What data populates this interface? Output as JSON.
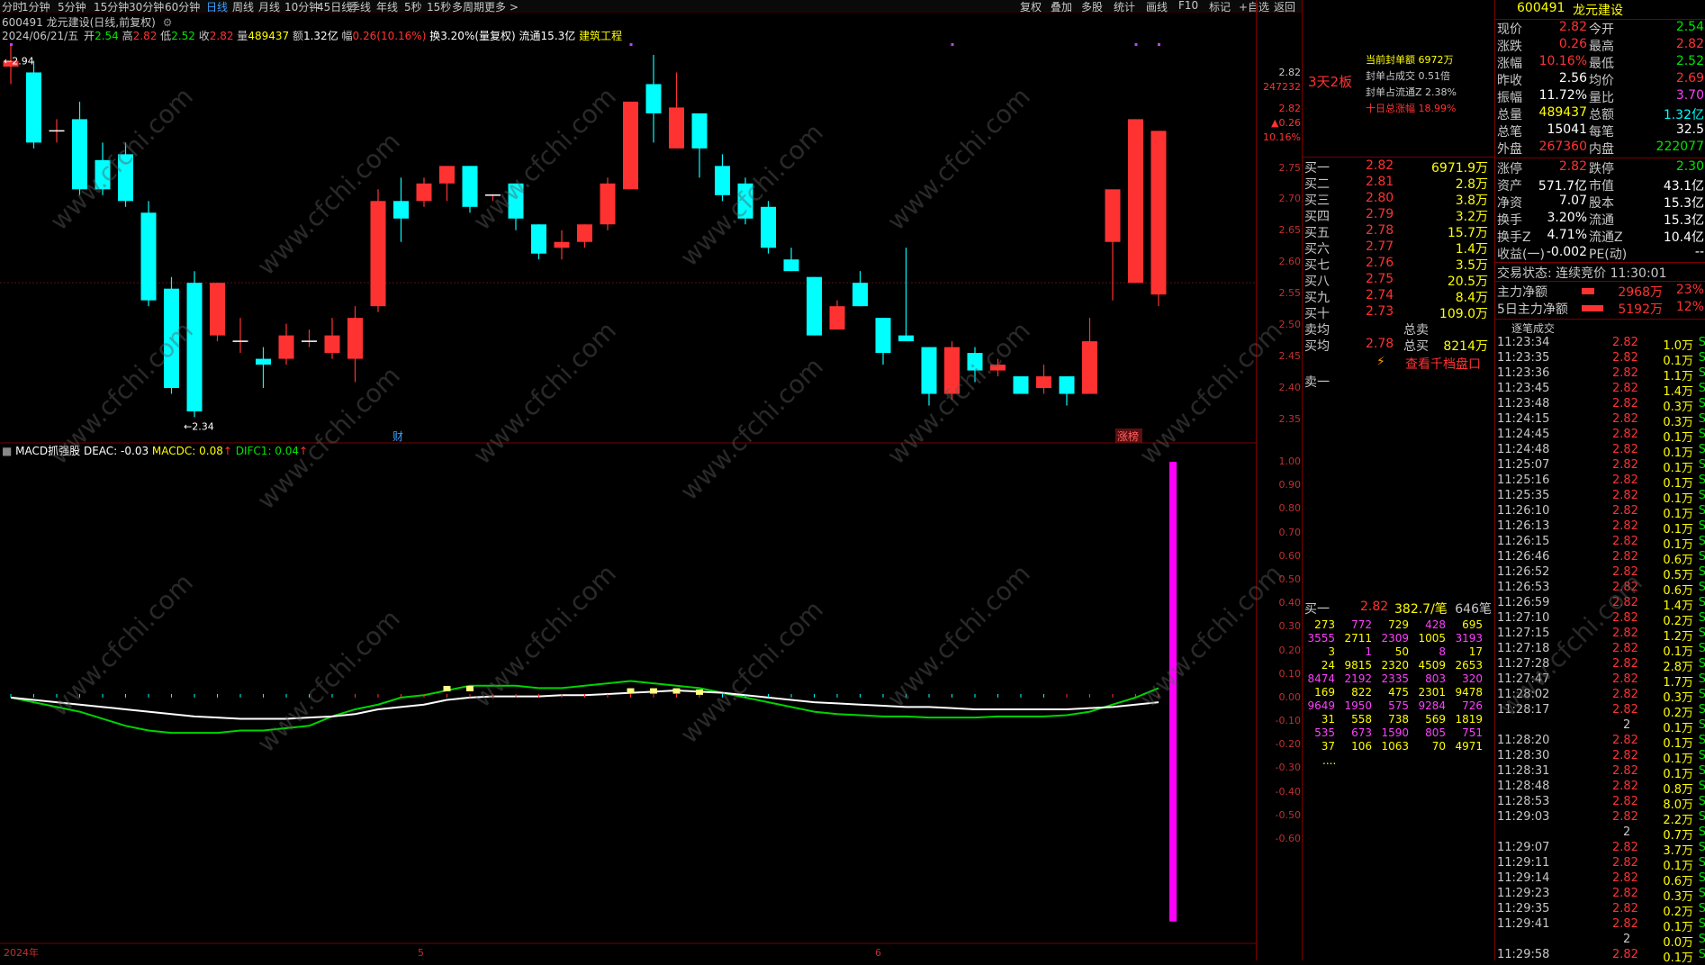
{
  "toolbar": {
    "periods": [
      "分时",
      "1分钟",
      "5分钟",
      "15分钟",
      "30分钟",
      "60分钟",
      "日线",
      "周线",
      "月线",
      "10分钟",
      "45日线",
      "季线",
      "年线",
      "5秒",
      "15秒",
      "多周期",
      "更多 >"
    ],
    "active": "日线",
    "right_tools": [
      "复权",
      "叠加",
      "多股",
      "统计",
      "画线",
      "F10",
      "标记",
      "+自选",
      "返回"
    ]
  },
  "chart": {
    "title": "600491 龙元建设(日线,前复权)",
    "date": "2024/06/21/五",
    "open_label": "开",
    "open": "2.54",
    "high_label": "高",
    "high": "2.82",
    "low_label": "低",
    "low": "2.52",
    "close_label": "收",
    "close": "2.82",
    "vol_label": "量",
    "vol": "489437",
    "amount_label": "额",
    "amount": "1.32亿",
    "change_label": "幅",
    "change": "0.26(10.16%)",
    "turnover": "换3.20%(量复权)",
    "float": "流通15.3亿",
    "sector": "建筑工程",
    "high_marker": "2.94",
    "low_marker": "2.34",
    "fin_marker": "财",
    "rank_marker": "涨榜",
    "price_axis": [
      "2.82",
      "247232",
      "2.82",
      "▲0.26",
      "10.16%",
      "2.75",
      "2.70",
      "2.65",
      "2.60",
      "2.55",
      "2.50",
      "2.45",
      "2.40",
      "2.35"
    ],
    "x_axis": [
      "2024年",
      "5",
      "6"
    ],
    "period_label": "日线"
  },
  "macd": {
    "title": "MACD抓强股",
    "deac": "DEAC: -0.03",
    "macdc": "MACDC: 0.08",
    "difc": "DIFC1: 0.04",
    "axis": [
      "1.00",
      "0.90",
      "0.80",
      "0.70",
      "0.60",
      "0.50",
      "0.40",
      "0.30",
      "0.20",
      "0.10",
      "0.00",
      "-0.10",
      "-0.20",
      "-0.30",
      "-0.40",
      "-0.50",
      "-0.60"
    ]
  },
  "chart_data": {
    "type": "candlestick",
    "candles": [
      [
        2.93,
        2.97,
        2.9,
        2.94
      ],
      [
        2.92,
        2.94,
        2.79,
        2.8
      ],
      [
        2.82,
        2.84,
        2.8,
        2.82
      ],
      [
        2.84,
        2.87,
        2.71,
        2.72
      ],
      [
        2.77,
        2.8,
        2.71,
        2.72
      ],
      [
        2.78,
        2.8,
        2.69,
        2.7
      ],
      [
        2.68,
        2.7,
        2.52,
        2.53
      ],
      [
        2.55,
        2.57,
        2.37,
        2.38
      ],
      [
        2.56,
        2.58,
        2.33,
        2.34
      ],
      [
        2.47,
        2.56,
        2.46,
        2.56
      ],
      [
        2.46,
        2.5,
        2.44,
        2.46
      ],
      [
        2.43,
        2.45,
        2.38,
        2.42
      ],
      [
        2.43,
        2.49,
        2.42,
        2.47
      ],
      [
        2.46,
        2.48,
        2.45,
        2.46
      ],
      [
        2.44,
        2.5,
        2.43,
        2.47
      ],
      [
        2.43,
        2.52,
        2.39,
        2.5
      ],
      [
        2.52,
        2.72,
        2.51,
        2.7
      ],
      [
        2.7,
        2.74,
        2.63,
        2.67
      ],
      [
        2.7,
        2.74,
        2.69,
        2.73
      ],
      [
        2.73,
        2.76,
        2.7,
        2.76
      ],
      [
        2.76,
        2.76,
        2.68,
        2.69
      ],
      [
        2.71,
        2.71,
        2.7,
        2.71
      ],
      [
        2.73,
        2.73,
        2.65,
        2.67
      ],
      [
        2.66,
        2.66,
        2.6,
        2.61
      ],
      [
        2.62,
        2.65,
        2.6,
        2.63
      ],
      [
        2.63,
        2.66,
        2.62,
        2.66
      ],
      [
        2.66,
        2.74,
        2.65,
        2.73
      ],
      [
        2.72,
        2.87,
        2.72,
        2.87
      ],
      [
        2.9,
        2.95,
        2.8,
        2.85
      ],
      [
        2.79,
        2.92,
        2.79,
        2.86
      ],
      [
        2.85,
        2.84,
        2.74,
        2.79
      ],
      [
        2.76,
        2.78,
        2.7,
        2.71
      ],
      [
        2.73,
        2.74,
        2.66,
        2.67
      ],
      [
        2.69,
        2.7,
        2.61,
        2.62
      ],
      [
        2.6,
        2.62,
        2.58,
        2.58
      ],
      [
        2.57,
        2.57,
        2.47,
        2.47
      ],
      [
        2.48,
        2.53,
        2.48,
        2.52
      ],
      [
        2.56,
        2.58,
        2.52,
        2.52
      ],
      [
        2.5,
        2.5,
        2.42,
        2.44
      ],
      [
        2.47,
        2.62,
        2.46,
        2.46
      ],
      [
        2.45,
        2.45,
        2.35,
        2.37
      ],
      [
        2.37,
        2.46,
        2.36,
        2.45
      ],
      [
        2.44,
        2.45,
        2.39,
        2.41
      ],
      [
        2.41,
        2.43,
        2.4,
        2.42
      ],
      [
        2.4,
        2.4,
        2.37,
        2.37
      ],
      [
        2.38,
        2.42,
        2.37,
        2.4
      ],
      [
        2.4,
        2.4,
        2.35,
        2.37
      ],
      [
        2.37,
        2.5,
        2.37,
        2.46
      ],
      [
        2.63,
        2.71,
        2.53,
        2.72
      ],
      [
        2.56,
        2.84,
        2.56,
        2.84
      ],
      [
        2.54,
        2.82,
        2.52,
        2.82
      ]
    ]
  },
  "orderbook": {
    "seal_title": "3天2板",
    "seal_amount": "当前封单额 6972万",
    "seal_ratio": "封单占成交 0.51倍",
    "seal_float": "封单占流通Z 2.38%",
    "ten_day": "十日总涨幅 18.99%",
    "bids": [
      {
        "label": "买一",
        "price": "2.82",
        "vol": "6971.9万"
      },
      {
        "label": "买二",
        "price": "2.81",
        "vol": "2.8万"
      },
      {
        "label": "买三",
        "price": "2.80",
        "vol": "3.8万"
      },
      {
        "label": "买四",
        "price": "2.79",
        "vol": "3.2万"
      },
      {
        "label": "买五",
        "price": "2.78",
        "vol": "15.7万"
      },
      {
        "label": "买六",
        "price": "2.77",
        "vol": "1.4万"
      },
      {
        "label": "买七",
        "price": "2.76",
        "vol": "3.5万"
      },
      {
        "label": "买八",
        "price": "2.75",
        "vol": "20.5万"
      },
      {
        "label": "买九",
        "price": "2.74",
        "vol": "8.4万"
      },
      {
        "label": "买十",
        "price": "2.73",
        "vol": "109.0万"
      }
    ],
    "sell_avg_label": "卖均",
    "total_sell_label": "总卖",
    "buy_avg_label": "买均",
    "buy_avg": "2.78",
    "total_buy_label": "总买",
    "total_buy": "8214万",
    "depth_link": "查看千档盘口",
    "ask1": "卖一",
    "bid1_label": "买一",
    "bid1_price": "2.82",
    "bid1_per": "382.7/笔",
    "bid1_count": "646笔",
    "queue": [
      [
        "273",
        "772",
        "729",
        "428",
        "695"
      ],
      [
        "3555",
        "2711",
        "2309",
        "1005",
        "3193"
      ],
      [
        "3",
        "1",
        "50",
        "8",
        "17"
      ],
      [
        "24",
        "9815",
        "2320",
        "4509",
        "2653"
      ],
      [
        "8474",
        "2192",
        "2335",
        "803",
        "320"
      ],
      [
        "169",
        "822",
        "475",
        "2301",
        "9478"
      ],
      [
        "9649",
        "1950",
        "575",
        "9284",
        "726"
      ],
      [
        "31",
        "558",
        "738",
        "569",
        "1819"
      ],
      [
        "535",
        "673",
        "1590",
        "805",
        "751"
      ],
      [
        "37",
        "106",
        "1063",
        "70",
        "4971"
      ]
    ],
    "more": "...."
  },
  "quote": {
    "code": "600491",
    "name": "龙元建设",
    "rows": [
      {
        "l1": "现价",
        "v1": "2.82",
        "l2": "今开",
        "v2": "2.54"
      },
      {
        "l1": "涨跌",
        "v1": "0.26",
        "l2": "最高",
        "v2": "2.82"
      },
      {
        "l1": "涨幅",
        "v1": "10.16%",
        "l2": "最低",
        "v2": "2.52"
      },
      {
        "l1": "昨收",
        "v1": "2.56",
        "l2": "均价",
        "v2": "2.69"
      },
      {
        "l1": "振幅",
        "v1": "11.72%",
        "l2": "量比",
        "v2": "3.70"
      },
      {
        "l1": "总量",
        "v1": "489437",
        "l2": "总额",
        "v2": "1.32亿"
      },
      {
        "l1": "总笔",
        "v1": "15041",
        "l2": "每笔",
        "v2": "32.5"
      },
      {
        "l1": "外盘",
        "v1": "267360",
        "l2": "内盘",
        "v2": "222077"
      }
    ],
    "rows2": [
      {
        "l1": "涨停",
        "v1": "2.82",
        "l2": "跌停",
        "v2": "2.30"
      },
      {
        "l1": "资产",
        "v1": "571.7亿",
        "l2": "市值",
        "v2": "43.1亿"
      },
      {
        "l1": "净资",
        "v1": "7.07",
        "l2": "股本",
        "v2": "15.3亿"
      },
      {
        "l1": "换手",
        "v1": "3.20%",
        "l2": "流通",
        "v2": "15.3亿"
      },
      {
        "l1": "换手Z",
        "v1": "4.71%",
        "l2": "流通Z",
        "v2": "10.4亿"
      },
      {
        "l1": "收益(一)",
        "v1": "-0.002",
        "l2": "PE(动)",
        "v2": "--"
      }
    ],
    "trade_status": "交易状态: 连续竞价 11:30:01",
    "main_net_label": "主力净额",
    "main_net": "2968万",
    "main_net_pct": "23%",
    "main5_label": "5日主力净额",
    "main5": "5192万",
    "main5_pct": "12%",
    "ticks_title": "逐笔成交",
    "ticks": [
      [
        "11:23:34",
        "2.82",
        "1.0万"
      ],
      [
        "11:23:35",
        "2.82",
        "0.1万"
      ],
      [
        "11:23:36",
        "2.82",
        "1.1万"
      ],
      [
        "11:23:45",
        "2.82",
        "1.4万"
      ],
      [
        "11:23:48",
        "2.82",
        "0.3万"
      ],
      [
        "11:24:15",
        "2.82",
        "0.3万"
      ],
      [
        "11:24:45",
        "2.82",
        "0.1万"
      ],
      [
        "11:24:48",
        "2.82",
        "0.1万"
      ],
      [
        "11:25:07",
        "2.82",
        "0.1万"
      ],
      [
        "11:25:16",
        "2.82",
        "0.1万"
      ],
      [
        "11:25:35",
        "2.82",
        "0.1万"
      ],
      [
        "11:26:10",
        "2.82",
        "0.1万"
      ],
      [
        "11:26:13",
        "2.82",
        "0.1万"
      ],
      [
        "11:26:15",
        "2.82",
        "0.1万"
      ],
      [
        "11:26:46",
        "2.82",
        "0.6万"
      ],
      [
        "11:26:52",
        "2.82",
        "0.5万"
      ],
      [
        "11:26:53",
        "2.82",
        "0.6万"
      ],
      [
        "11:26:59",
        "2.82",
        "1.4万"
      ],
      [
        "11:27:10",
        "2.82",
        "0.2万"
      ],
      [
        "11:27:15",
        "2.82",
        "1.2万"
      ],
      [
        "11:27:18",
        "2.82",
        "0.1万"
      ],
      [
        "11:27:28",
        "2.82",
        "2.8万"
      ],
      [
        "11:27:47",
        "2.82",
        "1.7万"
      ],
      [
        "11:28:02",
        "2.82",
        "0.3万"
      ],
      [
        "11:28:17",
        "2.82",
        "0.2万"
      ],
      [
        "",
        "2",
        "0.1万"
      ],
      [
        "11:28:20",
        "2.82",
        "0.1万"
      ],
      [
        "11:28:30",
        "2.82",
        "0.1万"
      ],
      [
        "11:28:31",
        "2.82",
        "0.1万"
      ],
      [
        "11:28:48",
        "2.82",
        "0.8万"
      ],
      [
        "11:28:53",
        "2.82",
        "8.0万"
      ],
      [
        "11:29:03",
        "2.82",
        "2.2万"
      ],
      [
        "",
        "2",
        "0.7万"
      ],
      [
        "11:29:07",
        "2.82",
        "3.7万"
      ],
      [
        "11:29:11",
        "2.82",
        "0.1万"
      ],
      [
        "11:29:14",
        "2.82",
        "0.6万"
      ],
      [
        "11:29:23",
        "2.82",
        "0.3万"
      ],
      [
        "11:29:35",
        "2.82",
        "0.2万"
      ],
      [
        "11:29:41",
        "2.82",
        "0.1万"
      ],
      [
        "",
        "2",
        "0.0万"
      ],
      [
        "11:29:58",
        "2.82",
        "0.1万"
      ]
    ],
    "tick_flag": "S"
  },
  "colors": {
    "up": "#ff3232",
    "down": "#00ffff",
    "ma_white": "#ffffff",
    "ma_green": "#00d400",
    "magenta": "#ff00ff",
    "grid": "#7a0000"
  },
  "watermark": "www.cfchi.com"
}
